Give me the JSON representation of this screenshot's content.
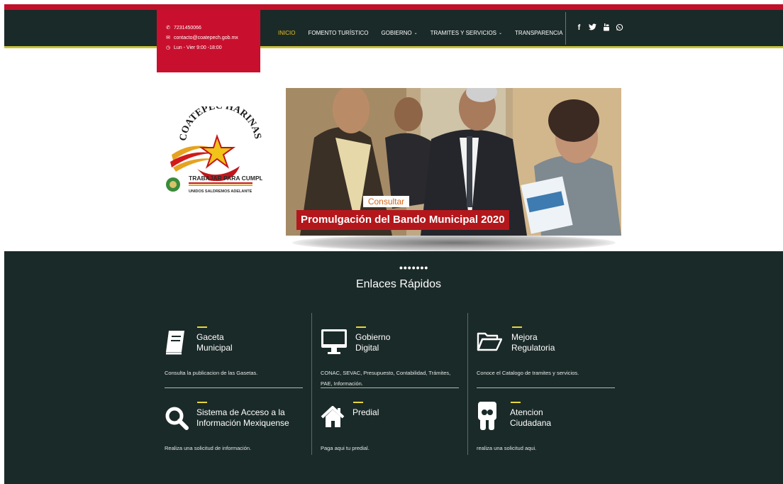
{
  "header": {
    "contact": {
      "phone": "7231450066",
      "email": "contacto@coatepech.gob.mx",
      "hours": "Lun - Vier 9:00 -18:00"
    },
    "menu": [
      {
        "label": "INICIO",
        "active": true
      },
      {
        "label": "FOMENTO TURÍSTICO"
      },
      {
        "label": "GOBIERNO",
        "dropdown": true
      },
      {
        "label": "TRAMITES Y SERVICIOS",
        "dropdown": true
      },
      {
        "label": "TRANSPARENCIA"
      }
    ],
    "social": [
      "facebook-icon",
      "twitter-icon",
      "youtube-icon",
      "whatsapp-icon"
    ]
  },
  "logo": {
    "top_text": "COATEPEC HARINAS",
    "slogan": "TRABAJAR PARA CUMPLIR",
    "subslogan": "UNIDOS SALDREMOS ADELANTE"
  },
  "hero": {
    "button": "Consultar",
    "caption": "Promulgación del Bando Municipal 2020"
  },
  "quick_links": {
    "dots": "•••••••",
    "title": "Enlaces Rápidos",
    "items": [
      {
        "title": "Gaceta\nMunicipal",
        "desc": "Consulta la publicacion de las Gasetas.",
        "icon": "book-icon"
      },
      {
        "title": "Gobierno\nDigital",
        "desc": "CONAC, SEVAC, Presupuesto, Contabilidad, Trámites, PAE, Información.",
        "icon": "monitor-icon"
      },
      {
        "title": "Mejora\nRegulatoria",
        "desc": "Conoce el Catalogo de tramites y servicios.",
        "icon": "folder-open-icon"
      },
      {
        "title": "Sistema de Acceso a la\nInformación Mexiquense",
        "desc": "Realiza una solicitud de información.",
        "icon": "search-icon"
      },
      {
        "title": "Predial",
        "desc": "Paga aqui tu predial.",
        "icon": "home-icon"
      },
      {
        "title": "Atencion\nCiudadana",
        "desc": "realiza una solicitud aqui.",
        "icon": "citizen-icon"
      }
    ]
  },
  "colors": {
    "brand_red": "#c8102e",
    "dark_bg": "#1a2a28",
    "accent_yellow": "#e6d63a",
    "active_menu": "#e8c02a"
  }
}
